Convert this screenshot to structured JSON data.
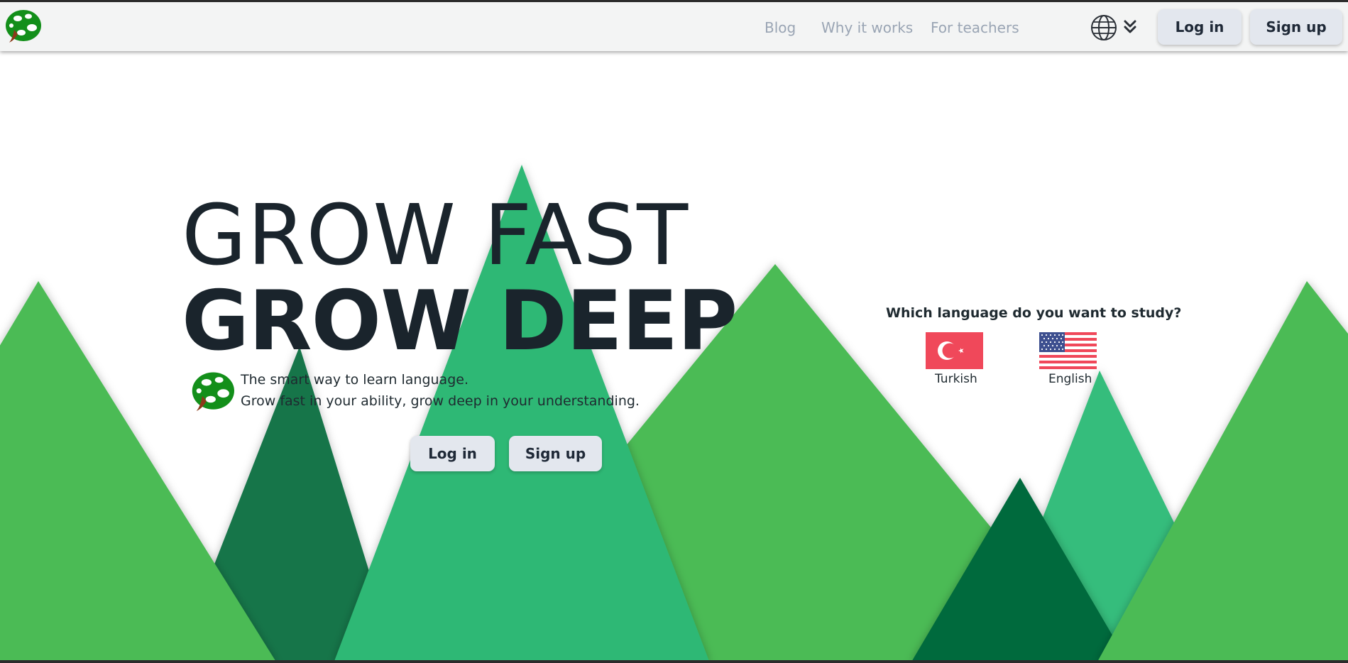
{
  "header": {
    "nav": [
      "Blog",
      "Why it works",
      "For teachers"
    ],
    "login_label": "Log in",
    "signup_label": "Sign up"
  },
  "hero": {
    "line1": "GROW FAST",
    "line2": "GROW DEEP",
    "tagline1": "The smart way to learn language.",
    "tagline2": "Grow fast in your ability, grow deep in your understanding.",
    "login_label": "Log in",
    "signup_label": "Sign up"
  },
  "language": {
    "question": "Which language do you want to study?",
    "options": [
      "Turkish",
      "English"
    ]
  },
  "colors": {
    "header_bg": "#f3f4f4",
    "nav_text": "#9aa5b4",
    "button_bg": "#e3e7ee",
    "heading": "#1a242c",
    "green_light": "#4cbb55",
    "green_teal": "#2db874",
    "green_dark": "#17744a",
    "green_darkest": "#046b3c"
  },
  "icons": [
    "logo-icon",
    "globe-icon",
    "chevron-double-down-icon",
    "turkey-flag-icon",
    "us-flag-icon"
  ]
}
